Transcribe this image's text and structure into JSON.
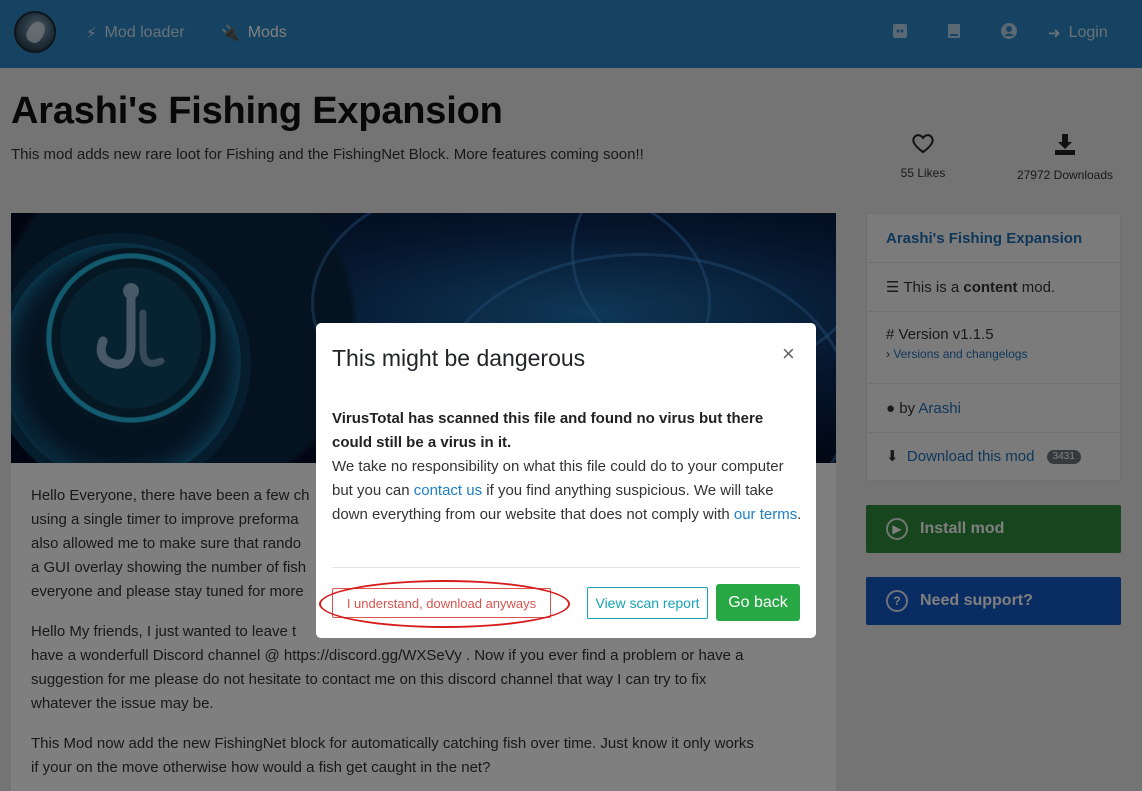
{
  "navbar": {
    "logo_icon": "app-logo",
    "modloader_label": "Mod loader",
    "mods_label": "Mods",
    "login_label": "Login",
    "icons": [
      "discord-icon",
      "book-icon",
      "user-circle-icon",
      "sign-in-icon"
    ]
  },
  "header": {
    "title": "Arashi's Fishing Expansion",
    "subtitle": "This mod adds new rare loot for Fishing and the FishingNet Block. More features coming soon!!",
    "likes": "55 Likes",
    "downloads": "27972 Downloads"
  },
  "content": {
    "paragraphs": [
      "Hello Everyone, there have been a few changes. using a single timer to improve preformance also allowed me to make sure that random a GUI overlay showing the number of fish everyone and please stay tuned for more",
      "Hello My friends, I just wanted to leave this message have a wonderfull Discord channel @ https://discord.gg/WXSeVy . Now if you ever find a problem or have a suggestion for me please do not hesitate to contact me on this discord channel that way I can try to fix whatever the issue may be.",
      "This Mod now add the new FishingNet block for automatically catching fish over time. Just know it only works if your on the move otherwise how would a fish get caught in the net?"
    ],
    "p1_lines": [
      "Hello Everyone, there have been a few ch",
      "using a single timer to improve preforma",
      "also allowed me to make sure that rando",
      "a GUI overlay showing the number of fish",
      "everyone and please stay tuned for more"
    ],
    "p2_lines": [
      "Hello My friends, I just wanted to leave t",
      "have a wonderfull Discord channel @ https://discord.gg/WXSeVy . Now if you ever find a problem or have a",
      "suggestion for me please do not hesitate to contact me on this discord channel that way I can try to fix",
      "whatever the issue may be."
    ],
    "p3_lines": [
      "This Mod now add the new FishingNet block for automatically catching fish over time. Just know it only works",
      "if your on the move otherwise how would a fish get caught in the net?"
    ]
  },
  "sidebar": {
    "mod_name": "Arashi's Fishing Expansion",
    "type_prefix": "This is a",
    "type_value": "content",
    "type_suffix": "mod.",
    "version": "Version v1.1.5",
    "versions_link": "Versions and changelogs",
    "by_prefix": "by",
    "author": "Arashi",
    "download_label": "Download this mod",
    "download_count": "3431",
    "install_label": "Install mod",
    "support_label": "Need support?"
  },
  "modal": {
    "title": "This might be dangerous",
    "warning_bold": "VirusTotal has scanned this file and found no virus but there could still be a virus in it.",
    "body_1": "We take no responsibility on what this file could do to your computer but you can",
    "contact_link": "contact us",
    "body_2": "if you find anything suspicious. We will take down everything from our website that does not comply with",
    "terms_link": "our terms",
    "body_3": ".",
    "btn_anyway": "I understand, download anyways",
    "btn_scan": "View scan report",
    "btn_back": "Go back",
    "close_glyph": "×"
  },
  "colors": {
    "navbar": "#2a86c2",
    "install": "#2e8b3a",
    "support": "#1258c5",
    "go_back": "#28a745",
    "danger": "#d9534f",
    "info": "#17a2b8",
    "annotation": "#d61d1d"
  }
}
